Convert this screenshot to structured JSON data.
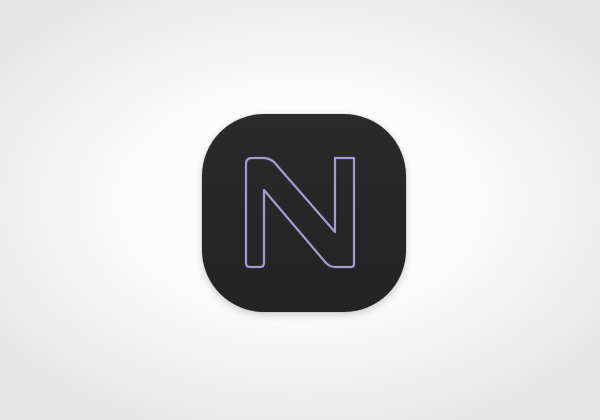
{
  "app_icon": {
    "glyph": "N",
    "icon": "letter-n-outline-icon",
    "background_color": "#262627",
    "stroke_color": "#a59ad2",
    "page_background": "#f4f4f4"
  }
}
